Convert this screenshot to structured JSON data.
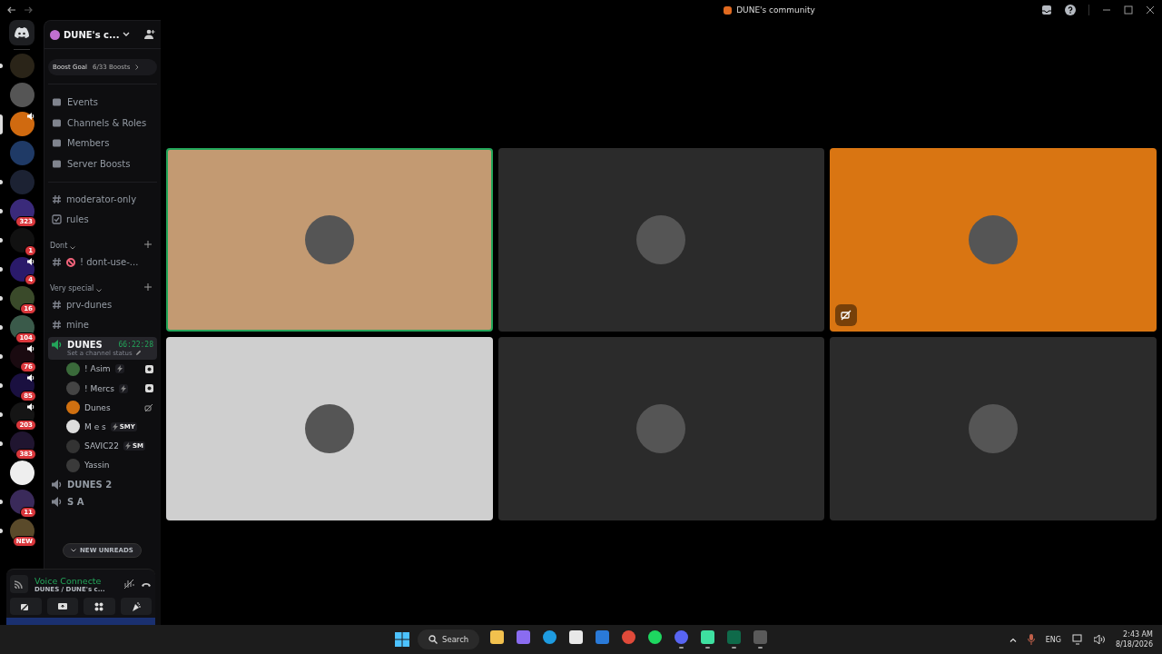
{
  "window": {
    "title": "DUNE's community"
  },
  "servers": [
    {
      "unread": true,
      "selected": false,
      "voice": false,
      "color": "#2a2418"
    },
    {
      "unread": false,
      "selected": false,
      "voice": false,
      "color": "#555555"
    },
    {
      "unread": false,
      "selected": true,
      "voice": true,
      "color": "#d06a10"
    },
    {
      "unread": false,
      "selected": false,
      "voice": false,
      "color": "#1f3a66"
    },
    {
      "unread": true,
      "selected": false,
      "voice": false,
      "color": "#1c2233"
    },
    {
      "badge": "323",
      "unread": true,
      "selected": false,
      "voice": false,
      "color": "#3a2a7a"
    },
    {
      "badge": "1",
      "unread": true,
      "selected": false,
      "voice": false,
      "color": "#111111"
    },
    {
      "badge": "4",
      "unread": true,
      "selected": false,
      "voice": true,
      "color": "#2a1a6a"
    },
    {
      "badge": "16",
      "unread": true,
      "selected": false,
      "voice": false,
      "color": "#3a4a2a"
    },
    {
      "badge": "104",
      "unread": true,
      "selected": false,
      "voice": false,
      "color": "#3a5a4a"
    },
    {
      "badge": "76",
      "unread": true,
      "selected": false,
      "voice": true,
      "color": "#1a0a10"
    },
    {
      "badge": "85",
      "unread": true,
      "selected": false,
      "voice": true,
      "color": "#1a1040"
    },
    {
      "badge": "203",
      "unread": true,
      "selected": false,
      "voice": true,
      "color": "#151515"
    },
    {
      "badge": "383",
      "unread": true,
      "selected": false,
      "voice": false,
      "color": "#201530"
    },
    {
      "unread": false,
      "selected": false,
      "voice": false,
      "color": "#eeeeee"
    },
    {
      "badge": "11",
      "unread": true,
      "selected": false,
      "voice": false,
      "color": "#3a2a5a"
    },
    {
      "badge": "NEW",
      "unread": true,
      "selected": false,
      "voice": false,
      "color": "#5a4a2a"
    }
  ],
  "server": {
    "name": "DUNE's c...",
    "boost_label": "Boost Goal",
    "boost_count": "6/33 Boosts"
  },
  "menu": [
    "Events",
    "Channels & Roles",
    "Members",
    "Server Boosts"
  ],
  "channels": [
    {
      "kind": "text",
      "name": "moderator-only",
      "selected": false
    },
    {
      "kind": "rules",
      "name": "rules",
      "selected": false
    },
    {
      "kind": "category",
      "name": "Dont"
    },
    {
      "kind": "blocked",
      "name": "! dont-use-...",
      "selected": false
    },
    {
      "kind": "category",
      "name": "Very special"
    },
    {
      "kind": "text",
      "name": "prv-dunes",
      "selected": false
    },
    {
      "kind": "text",
      "name": "mine",
      "selected": false
    },
    {
      "kind": "voice",
      "name": "DUNES",
      "selected": true,
      "timer": "66:22:28",
      "status": "Set a channel status",
      "children": [
        {
          "name": "! Asim",
          "boost": true,
          "streaming": true,
          "video_off": false,
          "color": "#3a6a3a"
        },
        {
          "name": "! Mercs",
          "boost": true,
          "streaming": true,
          "video_off": false,
          "color": "#444444"
        },
        {
          "name": "Dunes",
          "boost": false,
          "streaming": false,
          "video_off": true,
          "color": "#d07010"
        },
        {
          "name": "M e s",
          "boost": true,
          "tag": "SMY",
          "streaming": false,
          "video_off": false,
          "color": "#dddddd"
        },
        {
          "name": "SAVIC22",
          "boost": true,
          "tag": "SM",
          "streaming": false,
          "video_off": false,
          "color": "#333333"
        },
        {
          "name": "Yassin",
          "boost": false,
          "streaming": false,
          "video_off": false,
          "color": "#3a3a3a"
        }
      ]
    },
    {
      "kind": "voice",
      "name": "DUNES 2",
      "selected": false
    },
    {
      "kind": "voice",
      "name": "S A",
      "selected": false
    }
  ],
  "new_unreads": "NEW UNREADS",
  "voice_panel": {
    "status": "Voice Connecte",
    "location": "DUNES / DUNE's c..."
  },
  "tiles": [
    {
      "color": "#c39a72",
      "speaking": true,
      "video_off": false
    },
    {
      "color": "#2b2b2b",
      "speaking": false,
      "video_off": false
    },
    {
      "color": "#d97512",
      "speaking": false,
      "video_off": true
    },
    {
      "color": "#cfcfcf",
      "speaking": false,
      "video_off": false
    },
    {
      "color": "#2b2b2b",
      "speaking": false,
      "video_off": false
    },
    {
      "color": "#2b2b2b",
      "speaking": false,
      "video_off": false
    }
  ],
  "taskbar": {
    "search": "Search",
    "apps": [
      {
        "kind": "folder",
        "running": false
      },
      {
        "kind": "copilot",
        "running": false
      },
      {
        "kind": "edge",
        "running": false
      },
      {
        "kind": "store",
        "running": false
      },
      {
        "kind": "mail",
        "running": false
      },
      {
        "kind": "chrome",
        "running": false
      },
      {
        "kind": "spotify",
        "running": false
      },
      {
        "kind": "discord",
        "running": true
      },
      {
        "kind": "chat",
        "running": true
      },
      {
        "kind": "wave",
        "running": true
      },
      {
        "kind": "camera",
        "running": true
      }
    ],
    "language": "ENG",
    "time": "2:43 AM",
    "date": "8/18/2026"
  }
}
